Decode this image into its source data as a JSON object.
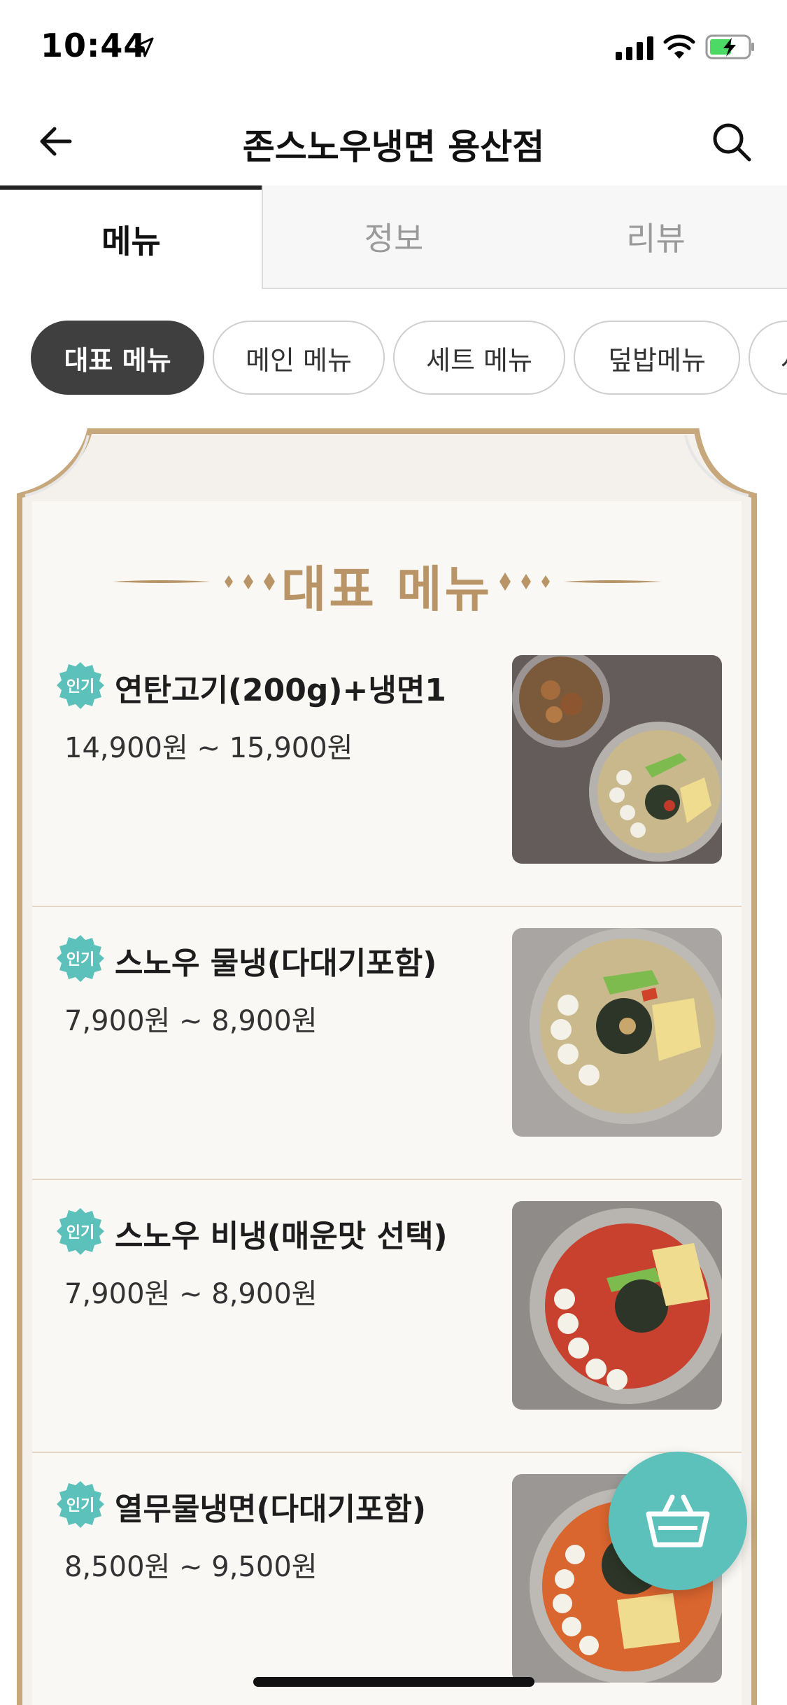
{
  "status_bar": {
    "time": "10:44",
    "icons": [
      "location-arrow-icon",
      "signal-icon",
      "wifi-icon",
      "battery-charging-icon"
    ]
  },
  "header": {
    "title": "존스노우냉면 용산점",
    "back_icon": "back-arrow-icon",
    "search_icon": "search-icon"
  },
  "tabs": [
    {
      "label": "메뉴",
      "active": true
    },
    {
      "label": "정보",
      "active": false
    },
    {
      "label": "리뷰",
      "active": false
    }
  ],
  "categories": [
    {
      "label": "대표 메뉴",
      "active": true
    },
    {
      "label": "메인 메뉴",
      "active": false
    },
    {
      "label": "세트 메뉴",
      "active": false
    },
    {
      "label": "덮밥메뉴",
      "active": false
    },
    {
      "label": "사",
      "active": false
    }
  ],
  "section": {
    "title": "대표 메뉴"
  },
  "items": [
    {
      "badge": "인기",
      "name": "연탄고기(200g)+냉면1",
      "price": "14,900원 ~ 15,900원",
      "photo": "grilled-pork-and-cold-noodle-photo"
    },
    {
      "badge": "인기",
      "name": "스노우 물냉(다대기포함)",
      "price": "7,900원 ~ 8,900원",
      "photo": "cold-broth-noodle-photo"
    },
    {
      "badge": "인기",
      "name": "스노우 비냉(매운맛 선택)",
      "price": "7,900원 ~ 8,900원",
      "photo": "spicy-mixed-noodle-photo"
    },
    {
      "badge": "인기",
      "name": "열무물냉면(다대기포함)",
      "price": "8,500원 ~ 9,500원",
      "photo": "radish-kimchi-cold-noodle-photo"
    }
  ],
  "colors": {
    "accent_teal": "#5cc1bb",
    "gold": "#b89466",
    "active_chip": "#3f3f3f"
  },
  "cart": {
    "icon": "shopping-basket-icon"
  }
}
